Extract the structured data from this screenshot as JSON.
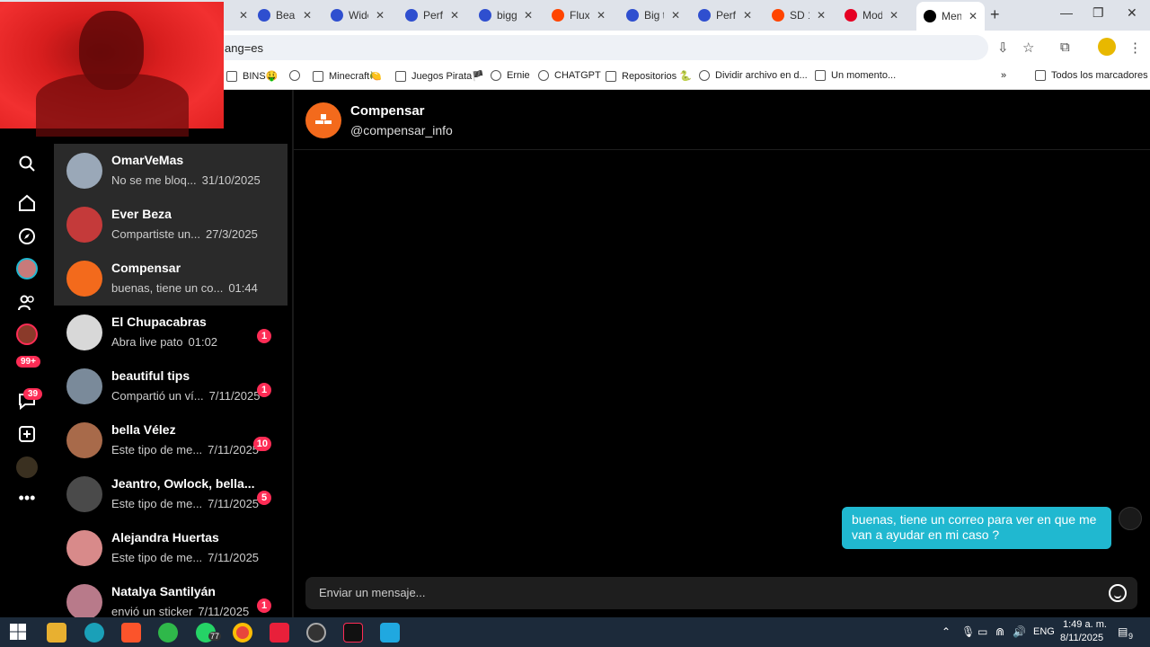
{
  "browser": {
    "tabs": [
      {
        "title": "Beau",
        "color": "#2f4fcf"
      },
      {
        "title": "Wide",
        "color": "#2f4fcf"
      },
      {
        "title": "Perfe",
        "color": "#2f4fcf"
      },
      {
        "title": "bigg",
        "color": "#2f4fcf"
      },
      {
        "title": "Flux",
        "color": "#ff4500"
      },
      {
        "title": "Big t",
        "color": "#2f4fcf"
      },
      {
        "title": "Perfe",
        "color": "#2f4fcf"
      },
      {
        "title": "SD 1",
        "color": "#ff4500"
      },
      {
        "title": "Mod",
        "color": "#e60023"
      },
      {
        "title": "Men",
        "color": "#000000"
      }
    ],
    "url": "ang=es",
    "bookmarks": [
      "BINS🤑",
      "Minecraft🍋",
      "Juegos Pirata🏴",
      "Ernie",
      "CHATGPT",
      "Repositorios 🐍",
      "Dividir archivo en d...",
      "Un momento...",
      "»",
      "Todos los marcadores"
    ]
  },
  "sidebar": {
    "badge_likes": "99+",
    "badge_inbox": "39"
  },
  "conversations": [
    {
      "name": "OmarVeMas",
      "preview": "No se me bloq...",
      "time": "31/10/2025",
      "badge": "",
      "avatar": "#9aa8b8"
    },
    {
      "name": "Ever Beza",
      "preview": "Compartiste un...",
      "time": "27/3/2025",
      "badge": "",
      "avatar": "#c43a3a"
    },
    {
      "name": "Compensar",
      "preview": "buenas, tiene un co...",
      "time": "01:44",
      "badge": "",
      "avatar": "#f36a1c"
    },
    {
      "name": "El Chupacabras",
      "preview": "Abra live pato",
      "time": "01:02",
      "badge": "1",
      "avatar": "#d8d8d8"
    },
    {
      "name": "beautiful tips",
      "preview": "Compartió un ví...",
      "time": "7/11/2025",
      "badge": "1",
      "avatar": "#7a8a9a"
    },
    {
      "name": "bella Vélez",
      "preview": "Este tipo de me...",
      "time": "7/11/2025",
      "badge": "10",
      "avatar": "#a86a4a"
    },
    {
      "name": "Jeantro, Owlock, bella...",
      "preview": "Este tipo de me...",
      "time": "7/11/2025",
      "badge": "5",
      "avatar": "#4a4a4a"
    },
    {
      "name": "Alejandra Huertas",
      "preview": "Este tipo de me...",
      "time": "7/11/2025",
      "badge": "",
      "avatar": "#d88a8a"
    },
    {
      "name": "Natalya Santilyán",
      "preview": "envió un sticker",
      "time": "7/11/2025",
      "badge": "1",
      "avatar": "#b87a8a"
    }
  ],
  "chat": {
    "name": "Compensar",
    "handle": "@compensar_info",
    "message": "buenas, tiene un correo para ver en que me van a ayudar en mi caso ?",
    "composer_placeholder": "Enviar un mensaje..."
  },
  "taskbar": {
    "whatsapp_badge": "77",
    "lang": "ENG",
    "time": "1:49 a. m.",
    "date": "8/11/2025",
    "notif_count": "9"
  }
}
